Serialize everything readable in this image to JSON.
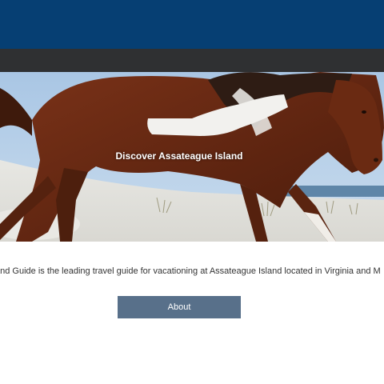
{
  "hero": {
    "title": "Discover Assateague Island",
    "image": "pinto-horse-running-on-beach"
  },
  "intro": {
    "text": "and Guide is the leading travel guide for vacationing at Assateague Island located in Virginia and M"
  },
  "actions": {
    "about_label": "About"
  },
  "colors": {
    "header": "#063f73",
    "navbar": "#2f3032",
    "button": "#58708a"
  }
}
